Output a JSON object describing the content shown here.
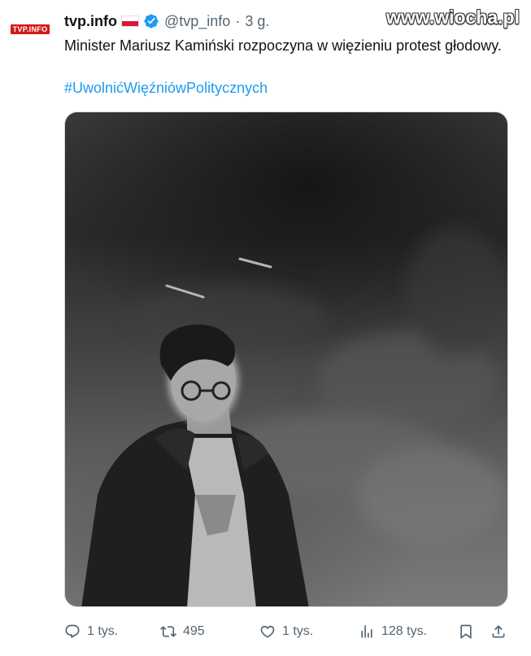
{
  "tweet": {
    "display_name": "tvp.info",
    "handle": "@tvp_info",
    "separator": "·",
    "time": "3 g.",
    "text": "Minister Mariusz Kamiński rozpoczyna w więzieniu protest głodowy.",
    "hashtag": "#UwolnićWięźniówPolitycznych",
    "avatar_label": "TVP.INFO"
  },
  "watermark": "www.wiocha.pl",
  "actions": {
    "replies": "1 tys.",
    "reposts": "495",
    "likes": "1 tys.",
    "views": "128 tys."
  },
  "icons": [
    "reply-icon",
    "repost-icon",
    "like-icon",
    "views-icon",
    "bookmark-icon",
    "share-icon",
    "verified-badge-icon",
    "poland-flag-icon"
  ],
  "colors": {
    "text": "#0f1419",
    "muted": "#536471",
    "link": "#1d9bf0",
    "verified": "#1d9bf0",
    "avatar_red": "#d11b1b"
  }
}
